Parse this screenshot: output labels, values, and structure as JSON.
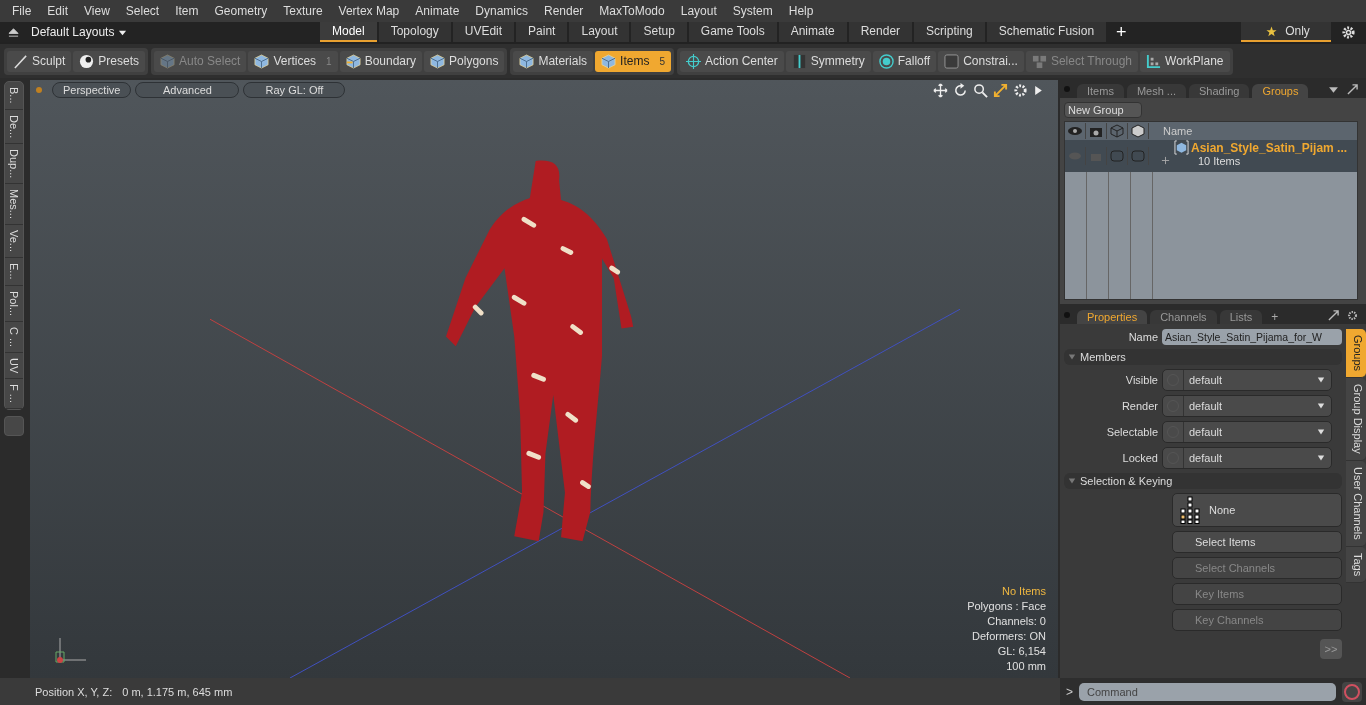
{
  "menu": [
    "File",
    "Edit",
    "View",
    "Select",
    "Item",
    "Geometry",
    "Texture",
    "Vertex Map",
    "Animate",
    "Dynamics",
    "Render",
    "MaxToModo",
    "Layout",
    "System",
    "Help"
  ],
  "layouts": {
    "label": "Default Layouts"
  },
  "layout_tabs": [
    {
      "label": "Model",
      "selected": true
    },
    {
      "label": "Topology",
      "selected": false
    },
    {
      "label": "UVEdit",
      "selected": false
    },
    {
      "label": "Paint",
      "selected": false
    },
    {
      "label": "Layout",
      "selected": false
    },
    {
      "label": "Setup",
      "selected": false
    },
    {
      "label": "Game Tools",
      "selected": false
    },
    {
      "label": "Animate",
      "selected": false
    },
    {
      "label": "Render",
      "selected": false
    },
    {
      "label": "Scripting",
      "selected": false
    },
    {
      "label": "Schematic Fusion",
      "selected": false
    }
  ],
  "add_tab": "+",
  "favorites": {
    "label": "Only",
    "selected": true
  },
  "toolbar_groups": [
    [
      {
        "label": "Sculpt",
        "kind": "brush",
        "selected": false,
        "disabled": false
      },
      {
        "label": "Presets",
        "kind": "ball",
        "selected": false,
        "disabled": false
      }
    ],
    [
      {
        "label": "Auto Select",
        "kind": "cube",
        "selected": false,
        "disabled": true
      },
      {
        "label": "Vertices",
        "kind": "vertex",
        "count": "1",
        "selected": false,
        "disabled": false
      },
      {
        "label": "Boundary",
        "kind": "edge",
        "selected": false,
        "disabled": false
      },
      {
        "label": "Polygons",
        "kind": "cube",
        "selected": false,
        "disabled": false
      }
    ],
    [
      {
        "label": "Materials",
        "kind": "cube",
        "selected": false,
        "disabled": false
      },
      {
        "label": "Items",
        "kind": "cube",
        "count": "5",
        "selected": true,
        "disabled": false
      }
    ],
    [
      {
        "label": "Action Center",
        "kind": "crosshair",
        "selected": false,
        "disabled": false
      },
      {
        "label": "Symmetry",
        "kind": "bar",
        "selected": false,
        "disabled": false
      },
      {
        "label": "Falloff",
        "kind": "ring",
        "selected": false,
        "disabled": false
      },
      {
        "label": "Constrai...",
        "kind": "square",
        "selected": false,
        "disabled": false
      },
      {
        "label": "Select Through",
        "kind": "cluster",
        "selected": false,
        "disabled": true
      },
      {
        "label": "WorkPlane",
        "kind": "plane",
        "selected": false,
        "disabled": false
      }
    ]
  ],
  "side_tabs": [
    "B...",
    "De...",
    "Dup...",
    "Mes...",
    "Ve...",
    "E...",
    "Pol...",
    "C ...",
    "UV",
    "F ..."
  ],
  "viewport": {
    "buttons": [
      "Perspective",
      "Advanced",
      "Ray GL: Off"
    ],
    "stats": [
      {
        "text": "No Items",
        "kind": "highlight"
      },
      {
        "text": "Polygons : Face",
        "kind": "plain"
      },
      {
        "text": "Channels: 0",
        "kind": "plain"
      },
      {
        "text": "Deformers: ON",
        "kind": "plain"
      },
      {
        "text": "GL: 6,154",
        "kind": "plain"
      },
      {
        "text": "100 mm",
        "kind": "plain"
      }
    ]
  },
  "status_bar": {
    "label": "Position X, Y, Z:",
    "value": "0 m, 1.175 m, 645 mm"
  },
  "groups_panel": {
    "tabs": [
      {
        "label": "Items",
        "selected": false
      },
      {
        "label": "Mesh ...",
        "selected": false
      },
      {
        "label": "Shading",
        "selected": false
      },
      {
        "label": "Groups",
        "selected": true
      }
    ],
    "new_group": "New Group",
    "name_column": "Name",
    "rows": [
      {
        "name": "Asian_Style_Satin_Pijam ...",
        "count": "10 Items",
        "expanded": false
      }
    ]
  },
  "properties": {
    "tabs": [
      {
        "label": "Properties",
        "selected": true
      },
      {
        "label": "Channels",
        "selected": false
      },
      {
        "label": "Lists",
        "selected": false
      }
    ],
    "add_tab": "+",
    "name_label": "Name",
    "name_value": "Asian_Style_Satin_Pijama_for_W",
    "members_title": "Members",
    "fields": [
      {
        "label": "Visible",
        "value": "default"
      },
      {
        "label": "Render",
        "value": "default"
      },
      {
        "label": "Selectable",
        "value": "default"
      },
      {
        "label": "Locked",
        "value": "default"
      }
    ],
    "keying_title": "Selection & Keying",
    "preset": "None",
    "buttons": [
      {
        "label": "Select Items",
        "disabled": false
      },
      {
        "label": "Select Channels",
        "disabled": true
      },
      {
        "label": "Key Items",
        "disabled": true
      },
      {
        "label": "Key Channels",
        "disabled": true
      }
    ],
    "more": ">>",
    "side_tabs": [
      {
        "label": "Groups",
        "selected": true
      },
      {
        "label": "Group Display",
        "selected": false
      },
      {
        "label": "User Channels",
        "selected": false
      },
      {
        "label": "Tags",
        "selected": false
      }
    ]
  },
  "command": {
    "prompt": ">",
    "placeholder": "Command"
  }
}
